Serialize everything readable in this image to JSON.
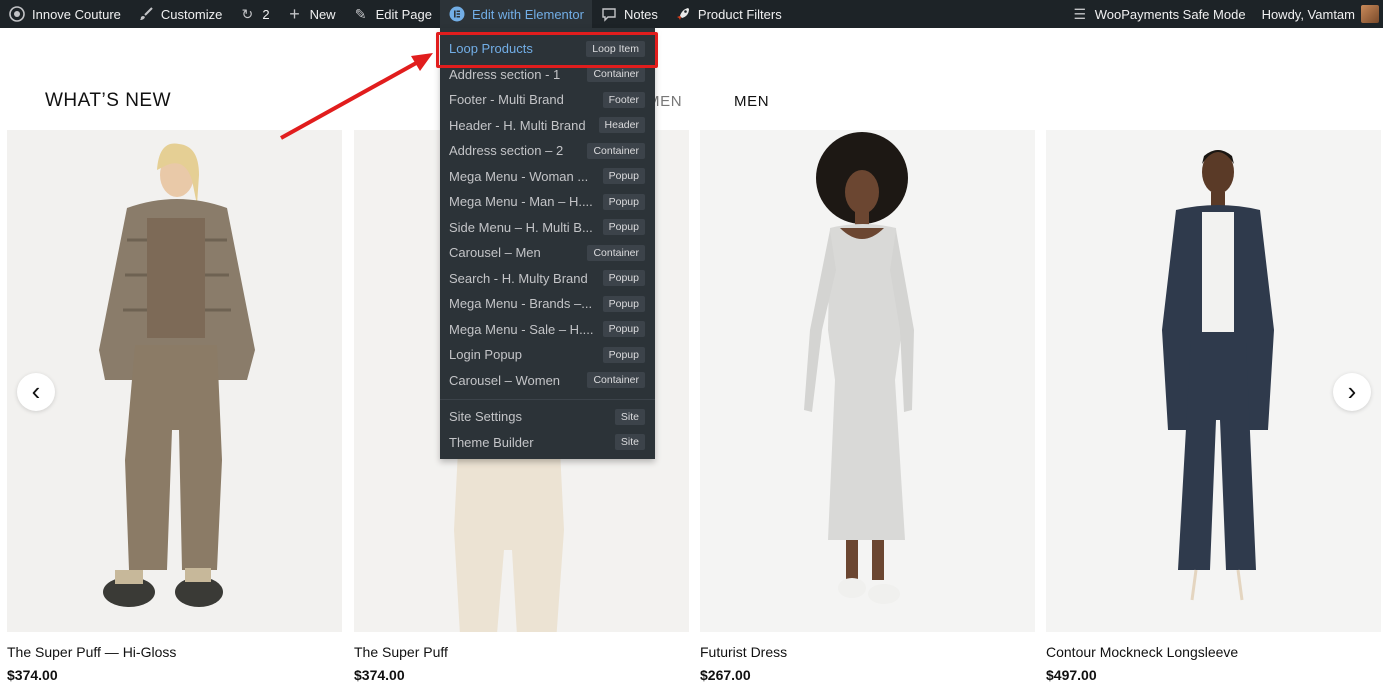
{
  "adminbar": {
    "site_name": "Innove Couture",
    "customize": "Customize",
    "updates_count": "2",
    "new": "New",
    "edit_page": "Edit Page",
    "edit_elementor": "Edit with Elementor",
    "notes": "Notes",
    "product_filters": "Product Filters",
    "safe_mode": "WooPayments Safe Mode",
    "howdy": "Howdy, Vamtam"
  },
  "section": {
    "heading": "WHAT’S NEW",
    "tab_women_partial": "MEN",
    "tab_men": "MEN"
  },
  "dropdown": {
    "items": [
      {
        "label": "Loop Products",
        "badge": "Loop Item"
      },
      {
        "label": "Address section - 1",
        "badge": "Container"
      },
      {
        "label": "Footer - Multi Brand",
        "badge": "Footer"
      },
      {
        "label": "Header - H. Multi Brand",
        "badge": "Header"
      },
      {
        "label": "Address section – 2",
        "badge": "Container"
      },
      {
        "label": "Mega Menu - Woman ...",
        "badge": "Popup"
      },
      {
        "label": "Mega Menu - Man – H....",
        "badge": "Popup"
      },
      {
        "label": "Side Menu – H. Multi B...",
        "badge": "Popup"
      },
      {
        "label": "Carousel – Men",
        "badge": "Container"
      },
      {
        "label": "Search - H. Multy Brand",
        "badge": "Popup"
      },
      {
        "label": "Mega Menu - Brands –...",
        "badge": "Popup"
      },
      {
        "label": "Mega Menu - Sale – H....",
        "badge": "Popup"
      },
      {
        "label": "Login Popup",
        "badge": "Popup"
      },
      {
        "label": "Carousel – Women",
        "badge": "Container"
      }
    ],
    "footer_items": [
      {
        "label": "Site Settings",
        "badge": "Site"
      },
      {
        "label": "Theme Builder",
        "badge": "Site"
      }
    ]
  },
  "products": [
    {
      "name": "The Super Puff — Hi-Gloss",
      "price": "$374.00"
    },
    {
      "name": "The Super Puff",
      "price": "$374.00"
    },
    {
      "name": "Futurist Dress",
      "price": "$267.00"
    },
    {
      "name": "Contour Mockneck Longsleeve",
      "price": "$497.00"
    }
  ],
  "carousel": {
    "prev_glyph": "‹",
    "next_glyph": "›"
  },
  "colors": {
    "adminbar": "#1d2327",
    "dropdown": "#2c3338",
    "accent": "#72aee6",
    "highlight": "#e11d1d"
  },
  "icons": [
    "wordpress-icon",
    "brush-icon",
    "refresh-icon",
    "plus-icon",
    "pencil-icon",
    "elementor-icon",
    "chat-icon",
    "rocket-icon",
    "safe-mode-icon"
  ]
}
